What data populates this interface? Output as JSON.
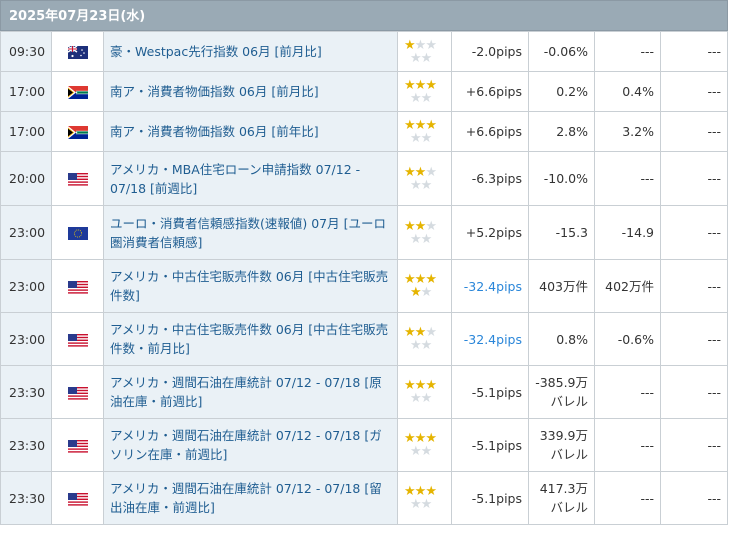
{
  "date_header": "2025年07月23日(水)",
  "rows": [
    {
      "time": "09:30",
      "country": "Australia",
      "flag": "au-flag-icon",
      "indicator": "豪・Westpac先行指数 06月 [前月比]",
      "stars": 1,
      "pips": "-2.0pips",
      "pips_color": "#333333",
      "result": "-0.06%",
      "forecast": "---",
      "previous": "---",
      "revised": "---"
    },
    {
      "time": "17:00",
      "country": "South Africa",
      "flag": "za-flag-icon",
      "indicator": "南ア・消費者物価指数 06月 [前月比]",
      "stars": 3,
      "pips": "+6.6pips",
      "pips_color": "#333333",
      "result": "0.2%",
      "forecast": "0.4%",
      "previous": "---",
      "revised": ""
    },
    {
      "time": "17:00",
      "country": "South Africa",
      "flag": "za-flag-icon",
      "indicator": "南ア・消費者物価指数 06月 [前年比]",
      "stars": 3,
      "pips": "+6.6pips",
      "pips_color": "#333333",
      "result": "2.8%",
      "forecast": "3.2%",
      "previous": "---",
      "revised": ""
    },
    {
      "time": "20:00",
      "country": "United States",
      "flag": "us-flag-icon",
      "indicator": "アメリカ・MBA住宅ローン申請指数 07/12 - 07/18 [前週比]",
      "stars": 2,
      "pips": "-6.3pips",
      "pips_color": "#333333",
      "result": "-10.0%",
      "forecast": "---",
      "previous": "---",
      "revised": ""
    },
    {
      "time": "23:00",
      "country": "Euro Area",
      "flag": "eu-flag-icon",
      "indicator": "ユーロ・消費者信頼感指数(速報値) 07月 [ユーロ圏消費者信頼感]",
      "stars": 2,
      "pips": "+5.2pips",
      "pips_color": "#333333",
      "result": "-15.3",
      "forecast": "-14.9",
      "previous": "---",
      "revised": ""
    },
    {
      "time": "23:00",
      "country": "United States",
      "flag": "us-flag-icon",
      "indicator": "アメリカ・中古住宅販売件数 06月 [中古住宅販売件数]",
      "stars": 4,
      "pips": "-32.4pips",
      "pips_color": "#2a86d9",
      "result": "403万件",
      "forecast": "402万件",
      "previous": "---",
      "revised": ""
    },
    {
      "time": "23:00",
      "country": "United States",
      "flag": "us-flag-icon",
      "indicator": "アメリカ・中古住宅販売件数 06月 [中古住宅販売件数・前月比]",
      "stars": 2,
      "pips": "-32.4pips",
      "pips_color": "#2a86d9",
      "result": "0.8%",
      "forecast": "-0.6%",
      "previous": "---",
      "revised": ""
    },
    {
      "time": "23:30",
      "country": "United States",
      "flag": "us-flag-icon",
      "indicator": "アメリカ・週間石油在庫統計 07/12 - 07/18 [原油在庫・前週比]",
      "stars": 3,
      "pips": "-5.1pips",
      "pips_color": "#333333",
      "result": "-385.9万\nバレル",
      "forecast": "---",
      "previous": "---",
      "revised": ""
    },
    {
      "time": "23:30",
      "country": "United States",
      "flag": "us-flag-icon",
      "indicator": "アメリカ・週間石油在庫統計 07/12 - 07/18 [ガソリン在庫・前週比]",
      "stars": 3,
      "pips": "-5.1pips",
      "pips_color": "#333333",
      "result": "339.9万\nバレル",
      "forecast": "---",
      "previous": "---",
      "revised": ""
    },
    {
      "time": "23:30",
      "country": "United States",
      "flag": "us-flag-icon",
      "indicator": "アメリカ・週間石油在庫統計 07/12 - 07/18 [留出油在庫・前週比]",
      "stars": 3,
      "pips": "-5.1pips",
      "pips_color": "#333333",
      "result": "417.3万\nバレル",
      "forecast": "---",
      "previous": "---",
      "revised": ""
    }
  ]
}
